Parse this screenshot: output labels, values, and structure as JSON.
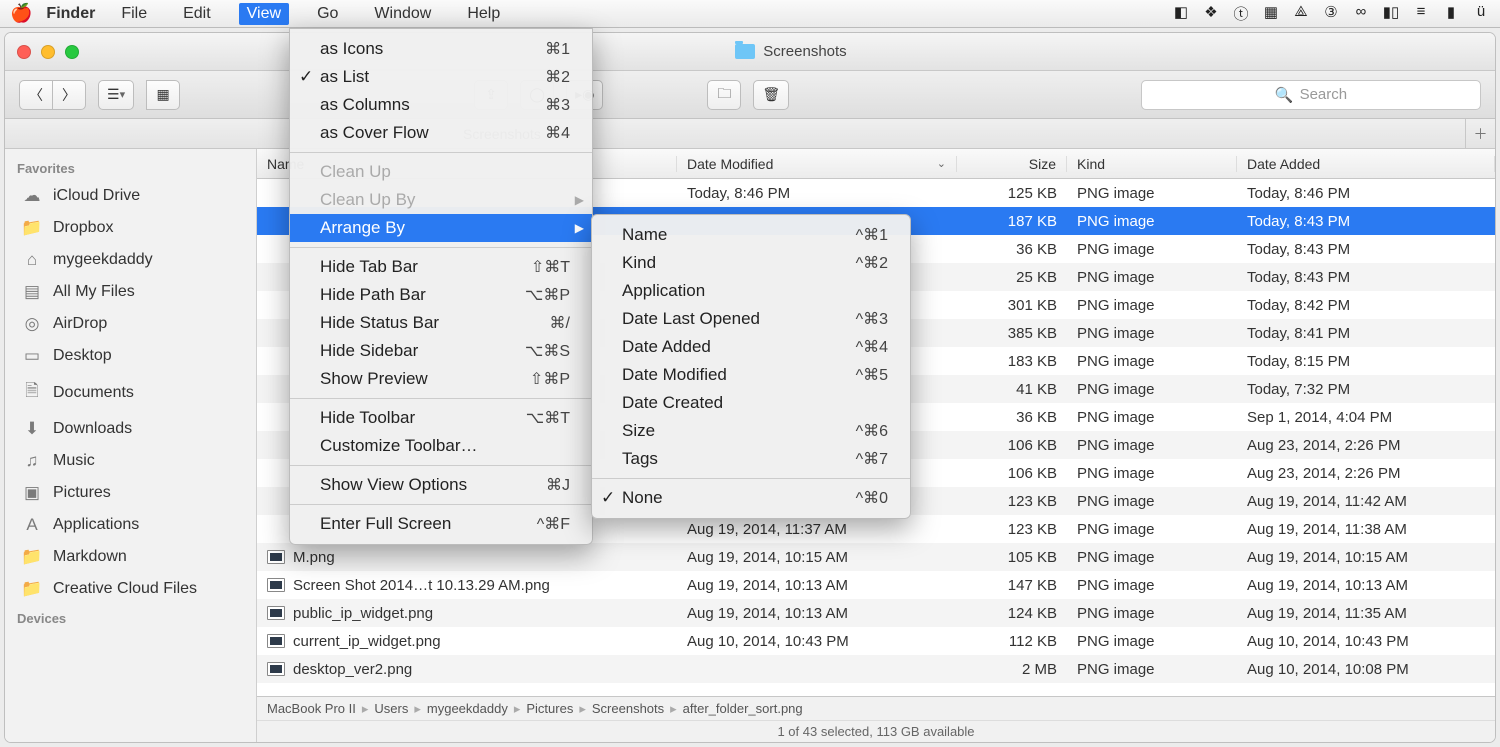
{
  "menubar": {
    "app": "Finder",
    "items": [
      "File",
      "Edit",
      "View",
      "Go",
      "Window",
      "Help"
    ],
    "open": "View"
  },
  "window": {
    "title": "Screenshots",
    "search_placeholder": "Search",
    "tab": "Screenshots"
  },
  "sidebar": {
    "section1": "Favorites",
    "items": [
      {
        "icon": "☁︎",
        "label": "iCloud Drive"
      },
      {
        "icon": "📁",
        "label": "Dropbox"
      },
      {
        "icon": "⌂",
        "label": "mygeekdaddy"
      },
      {
        "icon": "▤",
        "label": "All My Files"
      },
      {
        "icon": "◎",
        "label": "AirDrop"
      },
      {
        "icon": "▭",
        "label": "Desktop"
      },
      {
        "icon": "🗎",
        "label": "Documents"
      },
      {
        "icon": "⬇",
        "label": "Downloads"
      },
      {
        "icon": "♫",
        "label": "Music"
      },
      {
        "icon": "▣",
        "label": "Pictures"
      },
      {
        "icon": "A",
        "label": "Applications"
      },
      {
        "icon": "📁",
        "label": "Markdown"
      },
      {
        "icon": "📁",
        "label": "Creative Cloud Files"
      }
    ],
    "section2": "Devices"
  },
  "columns": {
    "name": "Name",
    "date": "Date Modified",
    "size": "Size",
    "kind": "Kind",
    "added": "Date Added"
  },
  "files": [
    {
      "name": "",
      "date": "Today, 8:46 PM",
      "size": "125 KB",
      "kind": "PNG image",
      "added": "Today, 8:46 PM",
      "sel": false
    },
    {
      "name": "",
      "date": "",
      "size": "187 KB",
      "kind": "PNG image",
      "added": "Today, 8:43 PM",
      "sel": true
    },
    {
      "name": "",
      "date": "",
      "size": "36 KB",
      "kind": "PNG image",
      "added": "Today, 8:43 PM",
      "sel": false
    },
    {
      "name": "",
      "date": "",
      "size": "25 KB",
      "kind": "PNG image",
      "added": "Today, 8:43 PM",
      "sel": false
    },
    {
      "name": "",
      "date": "",
      "size": "301 KB",
      "kind": "PNG image",
      "added": "Today, 8:42 PM",
      "sel": false
    },
    {
      "name": "",
      "date": "",
      "size": "385 KB",
      "kind": "PNG image",
      "added": "Today, 8:41 PM",
      "sel": false
    },
    {
      "name": "",
      "date": "",
      "size": "183 KB",
      "kind": "PNG image",
      "added": "Today, 8:15 PM",
      "sel": false
    },
    {
      "name": "",
      "date": "",
      "size": "41 KB",
      "kind": "PNG image",
      "added": "Today, 7:32 PM",
      "sel": false
    },
    {
      "name": "",
      "date": "",
      "size": "36 KB",
      "kind": "PNG image",
      "added": "Sep 1, 2014, 4:04 PM",
      "sel": false
    },
    {
      "name": "",
      "date": "",
      "size": "106 KB",
      "kind": "PNG image",
      "added": "Aug 23, 2014, 2:26 PM",
      "sel": false
    },
    {
      "name": "",
      "date": "",
      "size": "106 KB",
      "kind": "PNG image",
      "added": "Aug 23, 2014, 2:26 PM",
      "sel": false
    },
    {
      "name": "",
      "date": "",
      "size": "123 KB",
      "kind": "PNG image",
      "added": "Aug 19, 2014, 11:42 AM",
      "sel": false
    },
    {
      "name": "",
      "date": "Aug 19, 2014, 11:37 AM",
      "size": "123 KB",
      "kind": "PNG image",
      "added": "Aug 19, 2014, 11:38 AM",
      "sel": false
    },
    {
      "name": "M.png",
      "date": "Aug 19, 2014, 10:15 AM",
      "size": "105 KB",
      "kind": "PNG image",
      "added": "Aug 19, 2014, 10:15 AM",
      "sel": false
    },
    {
      "name": "Screen Shot 2014…t 10.13.29 AM.png",
      "date": "Aug 19, 2014, 10:13 AM",
      "size": "147 KB",
      "kind": "PNG image",
      "added": "Aug 19, 2014, 10:13 AM",
      "sel": false
    },
    {
      "name": "public_ip_widget.png",
      "date": "Aug 19, 2014, 10:13 AM",
      "size": "124 KB",
      "kind": "PNG image",
      "added": "Aug 19, 2014, 11:35 AM",
      "sel": false
    },
    {
      "name": "current_ip_widget.png",
      "date": "Aug 10, 2014, 10:43 PM",
      "size": "112 KB",
      "kind": "PNG image",
      "added": "Aug 10, 2014, 10:43 PM",
      "sel": false
    },
    {
      "name": "desktop_ver2.png",
      "date": "",
      "size": "2 MB",
      "kind": "PNG image",
      "added": "Aug 10, 2014, 10:08 PM",
      "sel": false
    }
  ],
  "pathbar": [
    "MacBook Pro II",
    "Users",
    "mygeekdaddy",
    "Pictures",
    "Screenshots",
    "after_folder_sort.png"
  ],
  "status": "1 of 43 selected, 113 GB available",
  "viewmenu": [
    {
      "label": "as Icons",
      "sc": "⌘1"
    },
    {
      "label": "as List",
      "sc": "⌘2",
      "check": true
    },
    {
      "label": "as Columns",
      "sc": "⌘3"
    },
    {
      "label": "as Cover Flow",
      "sc": "⌘4"
    },
    {
      "sep": true
    },
    {
      "label": "Clean Up",
      "dis": true
    },
    {
      "label": "Clean Up By",
      "dis": true,
      "arrow": true
    },
    {
      "label": "Arrange By",
      "hl": true,
      "arrow": true
    },
    {
      "sep": true
    },
    {
      "label": "Hide Tab Bar",
      "sc": "⇧⌘T"
    },
    {
      "label": "Hide Path Bar",
      "sc": "⌥⌘P"
    },
    {
      "label": "Hide Status Bar",
      "sc": "⌘/"
    },
    {
      "label": "Hide Sidebar",
      "sc": "⌥⌘S"
    },
    {
      "label": "Show Preview",
      "sc": "⇧⌘P"
    },
    {
      "sep": true
    },
    {
      "label": "Hide Toolbar",
      "sc": "⌥⌘T"
    },
    {
      "label": "Customize Toolbar…"
    },
    {
      "sep": true
    },
    {
      "label": "Show View Options",
      "sc": "⌘J"
    },
    {
      "sep": true
    },
    {
      "label": "Enter Full Screen",
      "sc": "^⌘F"
    }
  ],
  "submenu": [
    {
      "label": "Name",
      "sc": "^⌘1"
    },
    {
      "label": "Kind",
      "sc": "^⌘2"
    },
    {
      "label": "Application"
    },
    {
      "label": "Date Last Opened",
      "sc": "^⌘3"
    },
    {
      "label": "Date Added",
      "sc": "^⌘4"
    },
    {
      "label": "Date Modified",
      "sc": "^⌘5"
    },
    {
      "label": "Date Created"
    },
    {
      "label": "Size",
      "sc": "^⌘6"
    },
    {
      "label": "Tags",
      "sc": "^⌘7"
    },
    {
      "sep": true
    },
    {
      "label": "None",
      "sc": "^⌘0",
      "check": true
    }
  ]
}
